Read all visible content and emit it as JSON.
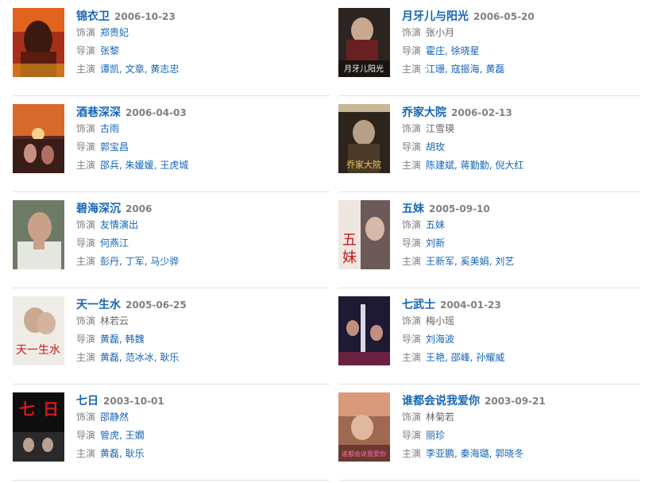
{
  "labels": {
    "role": "饰演",
    "director": "导演",
    "cast": "主演"
  },
  "movies": [
    {
      "title": "锦衣卫",
      "date": "2006-10-23",
      "role": "郑贵妃",
      "role_link": true,
      "director": "张黎",
      "cast": "谭凯, 文章, 黄志忠",
      "poster_color": "#b8331c"
    },
    {
      "title": "月牙儿与阳光",
      "date": "2006-05-20",
      "role": "张小月",
      "role_link": false,
      "director": "霍庄, 徐晓星",
      "cast": "江珊, 寇振海, 黄磊",
      "poster_color": "#3a2a26"
    },
    {
      "title": "酒巷深深",
      "date": "2006-04-03",
      "role": "古雨",
      "role_link": true,
      "director": "郭宝昌",
      "cast": "邵兵, 朱媛媛, 王虎城",
      "poster_color": "#8c3a2a"
    },
    {
      "title": "乔家大院",
      "date": "2006-02-13",
      "role": "江雪瑛",
      "role_link": false,
      "director": "胡玫",
      "cast": "陈建斌, 蒋勤勤, 倪大红",
      "poster_color": "#3b2f22"
    },
    {
      "title": "碧海深沉",
      "date": "2006",
      "role": "友情演出",
      "role_link": true,
      "director": "何燕江",
      "cast": "彭丹, 丁军, 马少骅",
      "poster_color": "#5d6d55"
    },
    {
      "title": "五妹",
      "date": "2005-09-10",
      "role": "五妹",
      "role_link": true,
      "director": "刘新",
      "cast": "王新军, 奚美娟, 刘艺",
      "poster_color": "#5a4a4a"
    },
    {
      "title": "天一生水",
      "date": "2005-06-25",
      "role": "林若云",
      "role_link": false,
      "director": "黄磊, 韩魏",
      "cast": "黄磊, 范冰冰, 耿乐",
      "poster_color": "#d9d4d0"
    },
    {
      "title": "七武士",
      "date": "2004-01-23",
      "role": "梅小瑶",
      "role_link": false,
      "director": "刘海波",
      "cast": "王艳, 邵峰, 孙耀威",
      "poster_color": "#2a2540"
    },
    {
      "title": "七日",
      "date": "2003-10-01",
      "role": "邵静然",
      "role_link": true,
      "director": "管虎, 王嫺",
      "cast": "黄磊, 耿乐",
      "poster_color": "#111111"
    },
    {
      "title": "谁都会说我爱你",
      "date": "2003-09-21",
      "role": "林菊若",
      "role_link": false,
      "director": "丽珍",
      "cast": "李亚鹏, 秦海璐, 郭晓冬",
      "poster_color": "#b8866a"
    }
  ]
}
